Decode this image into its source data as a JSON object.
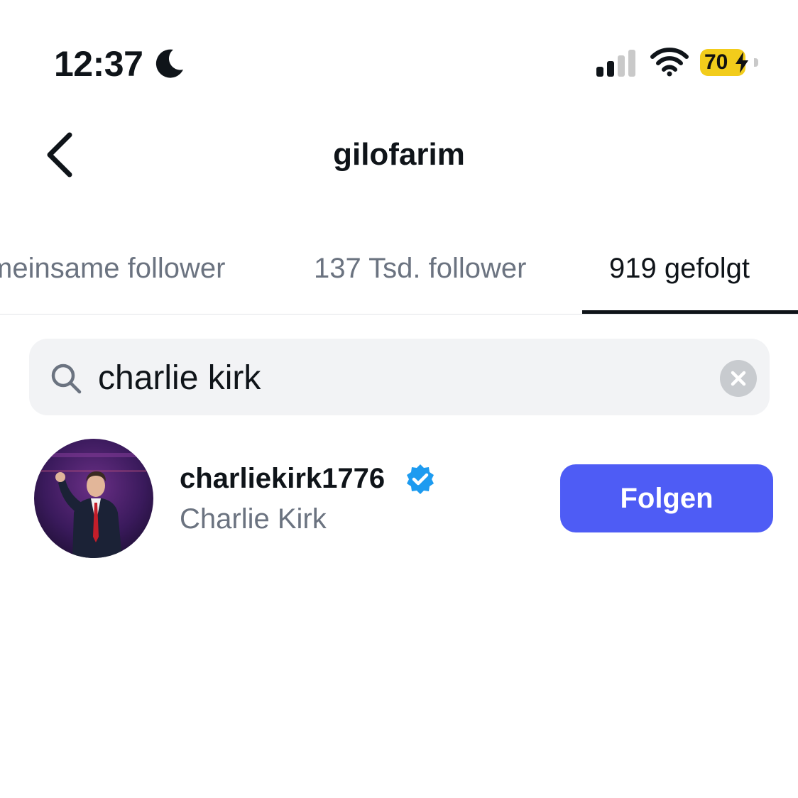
{
  "status_bar": {
    "time": "12:37",
    "focus_icon": "moon-icon",
    "signal_icon": "cellular-signal-icon",
    "wifi_icon": "wifi-icon",
    "battery_level": "70",
    "battery_charging": true,
    "battery_color": "#f2cc1b"
  },
  "header": {
    "back_icon": "chevron-left-icon",
    "title": "gilofarim"
  },
  "tabs": [
    {
      "label": "meinsame follower",
      "active": false
    },
    {
      "label": "137 Tsd. follower",
      "active": false
    },
    {
      "label": "919 gefolgt",
      "active": true
    }
  ],
  "search": {
    "icon": "search-icon",
    "value": "charlie kirk",
    "clear_icon": "close-icon"
  },
  "results": [
    {
      "username": "charliekirk1776",
      "verified": true,
      "full_name": "Charlie Kirk",
      "follow_label": "Folgen"
    }
  ],
  "colors": {
    "accent": "#4e5cf5",
    "verified": "#1d9bf0",
    "muted_text": "#6b7380",
    "search_bg": "#f2f3f5"
  }
}
